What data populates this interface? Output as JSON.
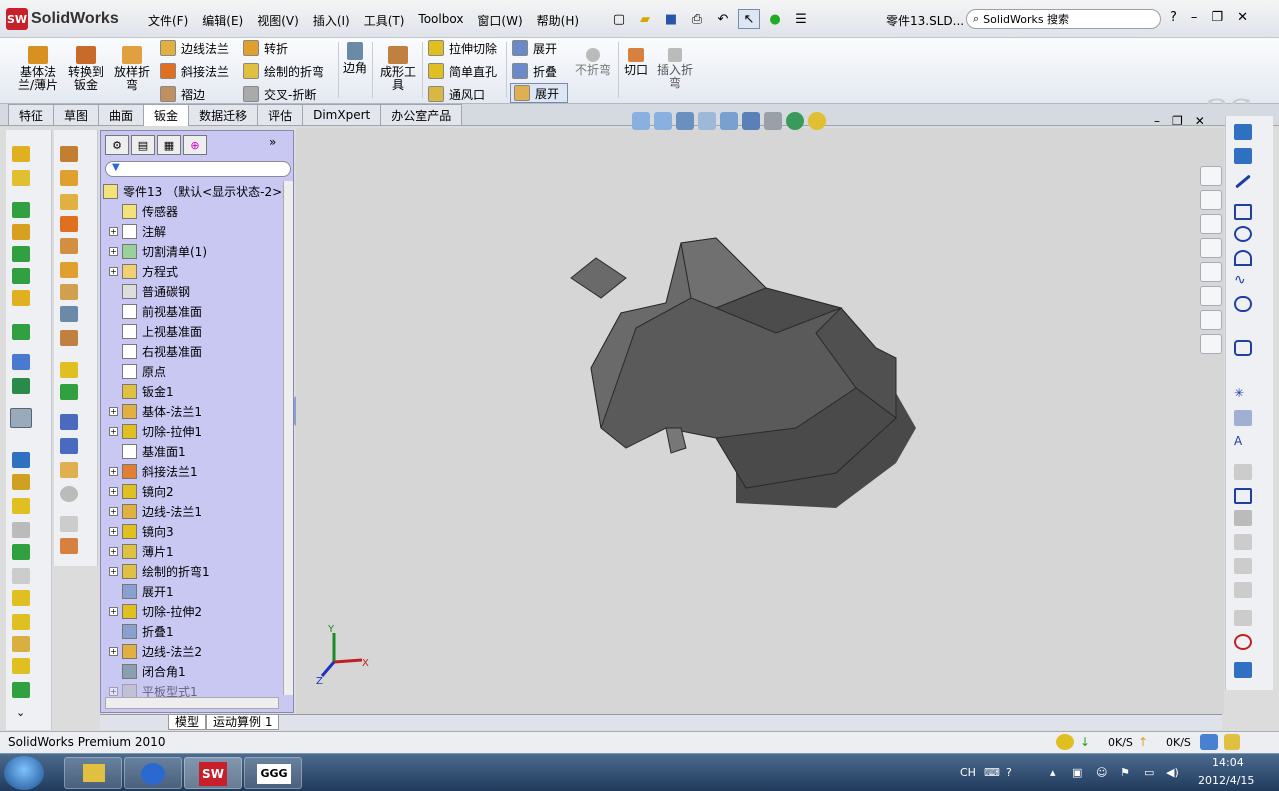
{
  "app": {
    "logo": "SolidWorks",
    "logo_badge": "SW",
    "doc_title": "零件13.SLD...",
    "search_placeholder": "SolidWorks 搜索"
  },
  "menus": [
    "文件(F)",
    "编辑(E)",
    "视图(V)",
    "插入(I)",
    "工具(T)",
    "Toolbox",
    "窗口(W)",
    "帮助(H)"
  ],
  "ribbon": {
    "base_flange": "基体法\n兰/薄片",
    "convert": "转换到\n钣金",
    "lofted": "放样折\n弯",
    "edge_flange": "边线法兰",
    "miter_flange": "斜接法兰",
    "hem": "褶边",
    "jog": "转折",
    "sketched_bend": "绘制的折弯",
    "cross_break": "交叉-折断",
    "corner": "边角",
    "forming_tool": "成形工\n具",
    "extruded_cut": "拉伸切除",
    "simple_hole": "简单直孔",
    "vent": "通风口",
    "unfold": "展开",
    "fold": "折叠",
    "flatten": "展开",
    "no_bends": "不折弯",
    "rip": "切口",
    "insert_bends": "插入折\n弯"
  },
  "tabs": [
    "特征",
    "草图",
    "曲面",
    "钣金",
    "数据迁移",
    "评估",
    "DimXpert",
    "办公室产品"
  ],
  "active_tab": "钣金",
  "feature_tree": {
    "root": "零件13 （默认<显示状态-2>）",
    "items": [
      {
        "label": "传感器",
        "exp": false
      },
      {
        "label": "注解",
        "exp": true
      },
      {
        "label": "切割清单(1)",
        "exp": true
      },
      {
        "label": "方程式",
        "exp": true
      },
      {
        "label": "普通碳钢",
        "exp": false
      },
      {
        "label": "前视基准面",
        "exp": false
      },
      {
        "label": "上视基准面",
        "exp": false
      },
      {
        "label": "右视基准面",
        "exp": false
      },
      {
        "label": "原点",
        "exp": false
      },
      {
        "label": "钣金1",
        "exp": false
      },
      {
        "label": "基体-法兰1",
        "exp": true
      },
      {
        "label": "切除-拉伸1",
        "exp": true
      },
      {
        "label": "基准面1",
        "exp": false
      },
      {
        "label": "斜接法兰1",
        "exp": true
      },
      {
        "label": "镜向2",
        "exp": true
      },
      {
        "label": "边线-法兰1",
        "exp": true
      },
      {
        "label": "镜向3",
        "exp": true
      },
      {
        "label": "薄片1",
        "exp": true
      },
      {
        "label": "绘制的折弯1",
        "exp": true
      },
      {
        "label": "展开1",
        "exp": false
      },
      {
        "label": "切除-拉伸2",
        "exp": true
      },
      {
        "label": "折叠1",
        "exp": false
      },
      {
        "label": "边线-法兰2",
        "exp": true
      },
      {
        "label": "闭合角1",
        "exp": false
      },
      {
        "label": "平板型式1",
        "exp": true
      }
    ]
  },
  "bottom_tabs": [
    "模型",
    "运动算例 1"
  ],
  "status": {
    "text": "SolidWorks Premium 2010",
    "down_rate": "0K/S",
    "up_rate": "0K/S"
  },
  "triad": {
    "x": "X",
    "y": "Y",
    "z": "Z"
  },
  "taskbar": {
    "lang": "CH",
    "time": "14:04",
    "date": "2012/4/15",
    "app_ggg": "GGG"
  },
  "colors": {
    "accent": "#c8202a",
    "tree_bg": "#c9c8f3",
    "viewport": "#d6d6d6",
    "model": "#5a5a5a"
  }
}
